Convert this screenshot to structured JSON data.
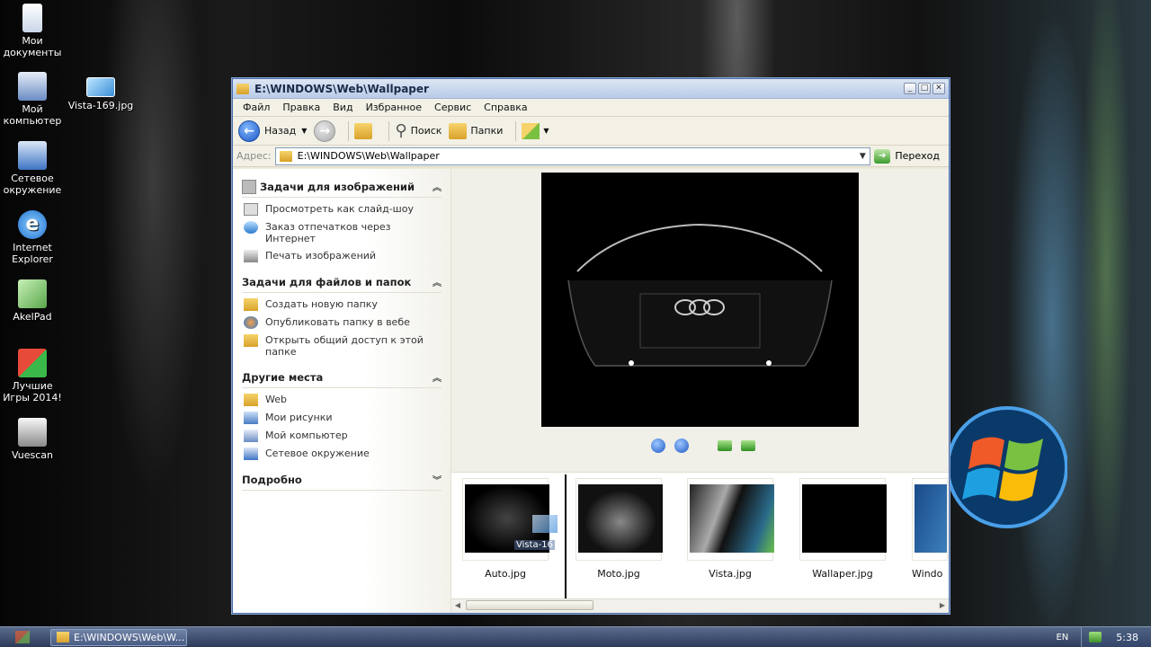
{
  "desktop": {
    "icons": [
      {
        "label": "Мои документы"
      },
      {
        "label": "Vista-169.jpg"
      },
      {
        "label": "Мой компьютер"
      },
      {
        "label": "Сетевое окружение"
      },
      {
        "label": "Internet Explorer"
      },
      {
        "label": "AkelPad"
      },
      {
        "label": "Лучшие Игры 2014!"
      },
      {
        "label": "Vuescan"
      }
    ]
  },
  "window": {
    "title": "E:\\WINDOWS\\Web\\Wallpaper",
    "menu": [
      "Файл",
      "Правка",
      "Вид",
      "Избранное",
      "Сервис",
      "Справка"
    ],
    "toolbar": {
      "back": "Назад",
      "search": "Поиск",
      "folders": "Папки"
    },
    "address": {
      "label": "Адрес:",
      "value": "E:\\WINDOWS\\Web\\Wallpaper",
      "go": "Переход"
    },
    "taskpane": {
      "image_tasks": {
        "title": "Задачи для изображений",
        "items": [
          "Просмотреть как слайд-шоу",
          "Заказ отпечатков через Интернет",
          "Печать изображений"
        ]
      },
      "file_tasks": {
        "title": "Задачи для файлов и папок",
        "items": [
          "Создать новую папку",
          "Опубликовать папку в вебе",
          "Открыть общий доступ к этой папке"
        ]
      },
      "other_places": {
        "title": "Другие места",
        "items": [
          "Web",
          "Мои рисунки",
          "Мой компьютер",
          "Сетевое окружение"
        ]
      },
      "details": {
        "title": "Подробно"
      }
    },
    "thumbnails": [
      {
        "label": "Auto.jpg"
      },
      {
        "label": "Moto.jpg"
      },
      {
        "label": "Vista.jpg"
      },
      {
        "label": "Wallaper.jpg"
      },
      {
        "label": "Windo"
      }
    ],
    "drag_label": "Vista-16"
  },
  "taskbar": {
    "task_label": "E:\\WINDOWS\\Web\\W...",
    "language": "EN",
    "clock": "5:38"
  },
  "colors": {
    "xp_blue": "#1e56c4",
    "folder_yellow": "#d8a22b"
  }
}
